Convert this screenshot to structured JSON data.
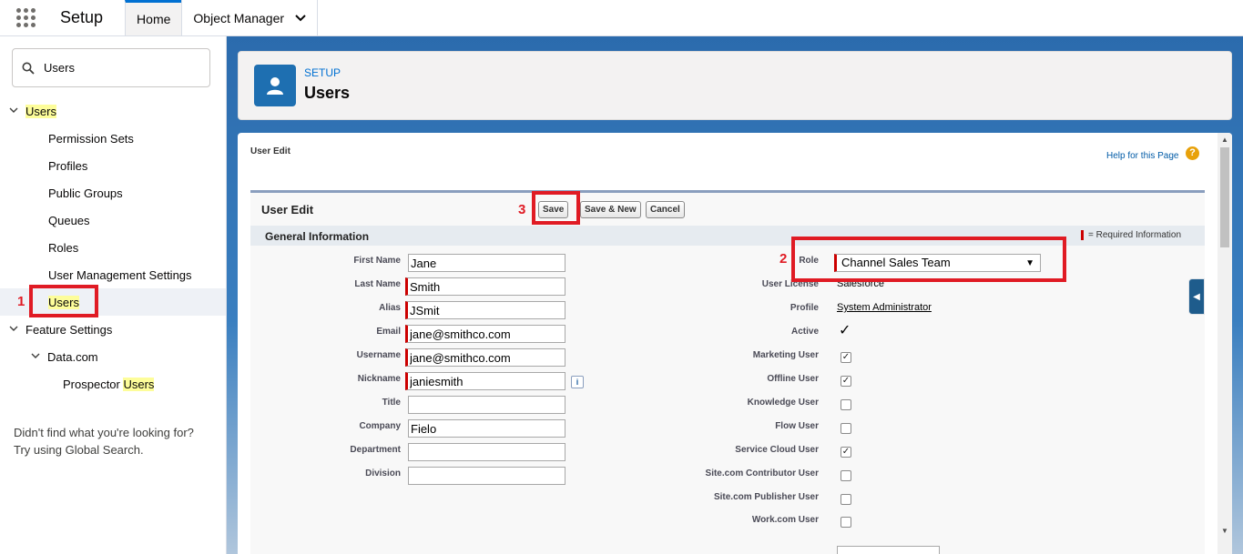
{
  "topbar": {
    "app_title": "Setup",
    "tabs": [
      {
        "label": "Home",
        "active": true
      },
      {
        "label": "Object Manager",
        "active": false
      }
    ]
  },
  "sidebar": {
    "search_value": "Users",
    "tree": {
      "users_root": "Users",
      "permission_sets": "Permission Sets",
      "profiles": "Profiles",
      "public_groups": "Public Groups",
      "queues": "Queues",
      "roles": "Roles",
      "user_management_settings": "User Management Settings",
      "users_child": "Users",
      "feature_settings": "Feature Settings",
      "data_com": "Data.com",
      "prospector_prefix": "Prospector ",
      "prospector_hl": "Users"
    },
    "note_line1": "Didn't find what you're looking for?",
    "note_line2": "Try using Global Search."
  },
  "header": {
    "eyebrow": "SETUP",
    "title": "Users"
  },
  "page": {
    "subtitle": "User Edit",
    "help_link": "Help for this Page",
    "help_icon_glyph": "?",
    "block_title": "User Edit",
    "buttons": {
      "save": "Save",
      "save_new": "Save & New",
      "cancel": "Cancel"
    },
    "section_title": "General Information",
    "required_legend": "= Required Information"
  },
  "form_left": {
    "first_name": {
      "label": "First Name",
      "value": "Jane"
    },
    "last_name": {
      "label": "Last Name",
      "value": "Smith"
    },
    "alias": {
      "label": "Alias",
      "value": "JSmit"
    },
    "email": {
      "label": "Email",
      "value": "jane@smithco.com"
    },
    "username": {
      "label": "Username",
      "value": "jane@smithco.com"
    },
    "nickname": {
      "label": "Nickname",
      "value": "janiesmith"
    },
    "title": {
      "label": "Title",
      "value": ""
    },
    "company": {
      "label": "Company",
      "value": "Fielo"
    },
    "department": {
      "label": "Department",
      "value": ""
    },
    "division": {
      "label": "Division",
      "value": ""
    }
  },
  "form_right": {
    "role": {
      "label": "Role",
      "value": "Channel Sales Team"
    },
    "user_license": {
      "label": "User License",
      "value": "Salesforce"
    },
    "profile": {
      "label": "Profile",
      "value": "System Administrator"
    },
    "active": {
      "label": "Active",
      "checked": true
    },
    "marketing_user": {
      "label": "Marketing User",
      "checked": true
    },
    "offline_user": {
      "label": "Offline User",
      "checked": true
    },
    "knowledge_user": {
      "label": "Knowledge User",
      "checked": false
    },
    "flow_user": {
      "label": "Flow User",
      "checked": false
    },
    "service_cloud_user": {
      "label": "Service Cloud User",
      "checked": true
    },
    "site_contributor": {
      "label": "Site.com Contributor User",
      "checked": false
    },
    "site_publisher": {
      "label": "Site.com Publisher User",
      "checked": false
    },
    "work_com": {
      "label": "Work.com User",
      "checked": false
    }
  },
  "annotations": {
    "step1": "1",
    "step2": "2",
    "step3": "3"
  },
  "colors": {
    "brand_blue": "#0070d2",
    "annotation_red": "#e01b24",
    "required_red": "#cc0000",
    "highlight_yellow": "#fdfd9a"
  },
  "icons": {
    "app_launcher": "waffle-icon",
    "object_manager_menu": "chevron-down-icon",
    "search": "search-icon",
    "tree_expanded": "chevron-down-icon",
    "header": "user-icon",
    "help": "help-icon",
    "nickname_info": "info-icon",
    "side_toggle": "chevron-left-icon"
  }
}
